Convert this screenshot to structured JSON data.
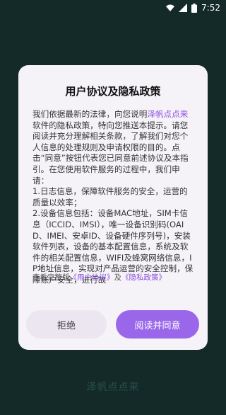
{
  "status_bar": {
    "time": "7:52"
  },
  "dialog": {
    "title": "用户协议及隐私政策",
    "body_intro": "我们依据最新的法律，向您说明",
    "app_name": "泽帆点点来",
    "body_text": "软件的隐私政策，特向您推送本提示。请您阅读并充分理解相关条款，了解我们对您个人信息的处理规则及申请权限的目的。点击“同意”按钮代表您已同意前述协议及本指引。在您使用软件服务的过程中，我们申请：\n1.日志信息，保障软件服务的安全，运营的质量以效率；\n2.设备信息包括：设备MAC地址，SIM卡信息（ICCID、IMSI），唯一设备识别码(OAID、IMEI、安卓ID、设备硬件序列号)，安装软件列表，设备的基本配置信息，系统及软件的相关配置信息，WIFI及蜂窝网络信息，IP地址信息，实现对产品运营的安全控制，保障账户安全，进行故",
    "footer_prefix": "查看完整版",
    "user_agreement": "《用户协议》",
    "footer_and": "及",
    "privacy_policy": "《隐私政策》",
    "reject_label": "拒绝",
    "agree_label": "阅读并同意"
  },
  "bottom_brand": "泽帆点点来",
  "colors": {
    "background": "#142a28",
    "accent": "#9a67ea",
    "link": "#8a4fe0"
  }
}
